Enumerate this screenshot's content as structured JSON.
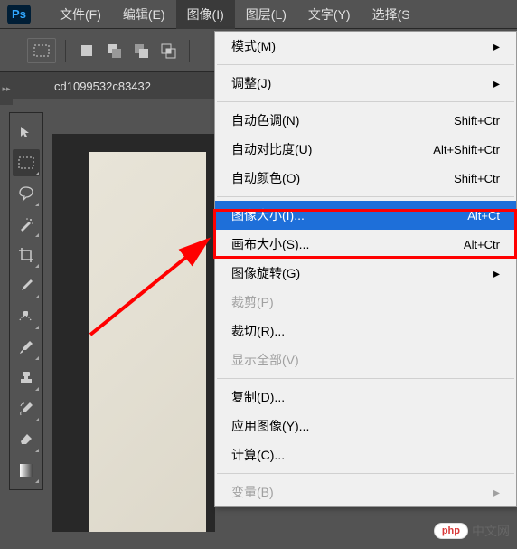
{
  "app": {
    "logo": "Ps"
  },
  "menubar": {
    "items": [
      {
        "label": "文件(F)"
      },
      {
        "label": "编辑(E)"
      },
      {
        "label": "图像(I)",
        "active": true
      },
      {
        "label": "图层(L)"
      },
      {
        "label": "文字(Y)"
      },
      {
        "label": "选择(S"
      }
    ]
  },
  "doc_tab": "cd1099532c83432",
  "dropdown": {
    "items": [
      {
        "label": "模式(M)",
        "shortcut": "",
        "type": "submenu"
      },
      {
        "sep": true
      },
      {
        "label": "调整(J)",
        "shortcut": "",
        "type": "submenu"
      },
      {
        "sep": true
      },
      {
        "label": "自动色调(N)",
        "shortcut": "Shift+Ctr"
      },
      {
        "label": "自动对比度(U)",
        "shortcut": "Alt+Shift+Ctr"
      },
      {
        "label": "自动颜色(O)",
        "shortcut": "Shift+Ctr"
      },
      {
        "sep": true
      },
      {
        "label": "图像大小(I)...",
        "shortcut": "Alt+Ct",
        "highlighted": true
      },
      {
        "label": "画布大小(S)...",
        "shortcut": "Alt+Ctr"
      },
      {
        "label": "图像旋转(G)",
        "shortcut": "",
        "type": "submenu"
      },
      {
        "label": "裁剪(P)",
        "shortcut": "",
        "disabled": true
      },
      {
        "label": "裁切(R)...",
        "shortcut": ""
      },
      {
        "label": "显示全部(V)",
        "shortcut": "",
        "disabled": true
      },
      {
        "sep": true
      },
      {
        "label": "复制(D)...",
        "shortcut": ""
      },
      {
        "label": "应用图像(Y)...",
        "shortcut": ""
      },
      {
        "label": "计算(C)...",
        "shortcut": ""
      },
      {
        "sep": true
      },
      {
        "label": "变量(B)",
        "shortcut": "",
        "disabled": true,
        "type": "submenu"
      }
    ]
  },
  "watermark": {
    "badge": "php",
    "text": "中文网"
  }
}
